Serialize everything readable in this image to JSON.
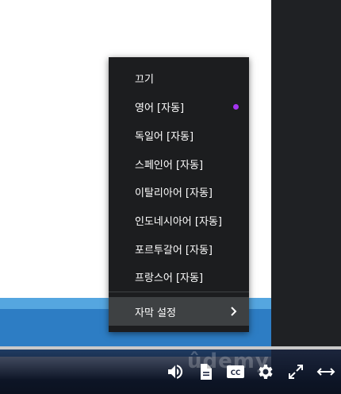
{
  "player": {
    "watermark": "ûdemy",
    "progress_fraction": 0.0
  },
  "caption_menu": {
    "items": [
      {
        "label": "끄기",
        "selected": false
      },
      {
        "label": "영어 [자동]",
        "selected": true
      },
      {
        "label": "독일어 [자동]",
        "selected": false
      },
      {
        "label": "스페인어 [자동]",
        "selected": false
      },
      {
        "label": "이탈리아어 [자동]",
        "selected": false
      },
      {
        "label": "인도네시아어 [자동]",
        "selected": false
      },
      {
        "label": "포르투갈어 [자동]",
        "selected": false
      },
      {
        "label": "프랑스어 [자동]",
        "selected": false
      }
    ],
    "settings_label": "자막 설정",
    "accent_color": "#a435f0"
  },
  "controls": {
    "icons": [
      "volume-icon",
      "transcript-icon",
      "captions-icon",
      "settings-icon",
      "fullscreen-icon",
      "expand-icon"
    ],
    "captions_label": "CC"
  }
}
